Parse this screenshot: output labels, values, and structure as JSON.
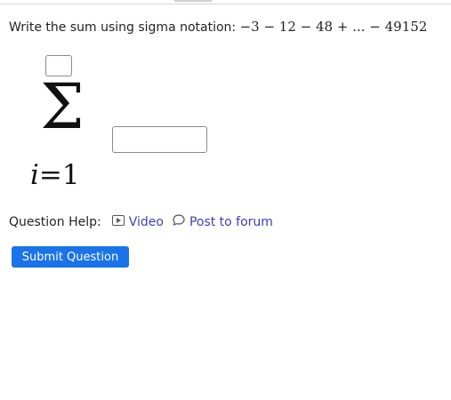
{
  "question": {
    "prompt": "Write the sum using sigma notation:",
    "series": "−3 − 12 − 48 + ... − 49152"
  },
  "sigma": {
    "symbol": "Σ",
    "index_var": "i",
    "equals": "=",
    "start": "1"
  },
  "help": {
    "label": "Question Help:",
    "video": "Video",
    "forum": "Post to forum"
  },
  "actions": {
    "submit": "Submit Question"
  },
  "colors": {
    "link": "#3f3fb0",
    "submit_bg": "#1a73e8"
  }
}
